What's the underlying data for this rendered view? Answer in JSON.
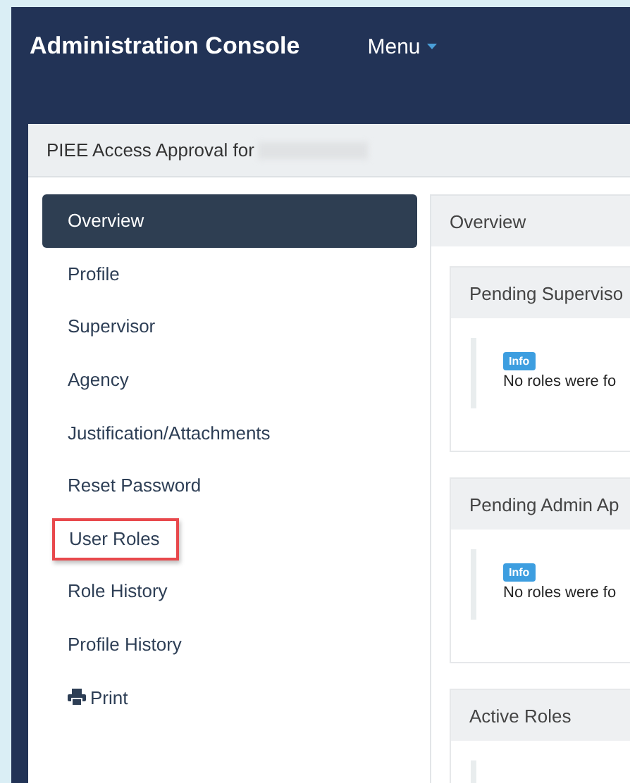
{
  "header": {
    "title": "Administration Console",
    "menu": "Menu"
  },
  "panel": {
    "title": "PIEE Access Approval for"
  },
  "nav": [
    {
      "label": "Overview",
      "selected": true,
      "highlighted": false
    },
    {
      "label": "Profile",
      "selected": false,
      "highlighted": false
    },
    {
      "label": "Supervisor",
      "selected": false,
      "highlighted": false
    },
    {
      "label": "Agency",
      "selected": false,
      "highlighted": false
    },
    {
      "label": "Justification/Attachments",
      "selected": false,
      "highlighted": false
    },
    {
      "label": "Reset Password",
      "selected": false,
      "highlighted": false
    },
    {
      "label": "User Roles",
      "selected": false,
      "highlighted": true
    },
    {
      "label": "Role History",
      "selected": false,
      "highlighted": false
    },
    {
      "label": "Profile History",
      "selected": false,
      "highlighted": false
    },
    {
      "label": "Print",
      "selected": false,
      "highlighted": false,
      "kind": "print"
    }
  ],
  "content": {
    "title": "Overview",
    "cards": [
      {
        "title": "Pending Superviso",
        "badge": "Info",
        "message": "No roles were fo"
      },
      {
        "title": "Pending Admin Ap",
        "badge": "Info",
        "message": "No roles were fo"
      },
      {
        "title": "Active Roles"
      }
    ]
  }
}
